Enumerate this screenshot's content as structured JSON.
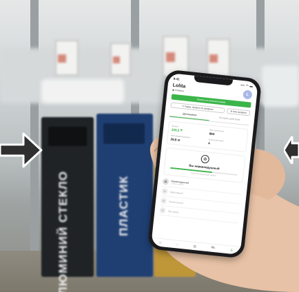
{
  "background": {
    "bins": [
      {
        "label": "АЛЮМИНИЙ СТЕКЛО",
        "color": "#1f2326"
      },
      {
        "label": "ПЛАСТИК",
        "color": "#1f3f73"
      }
    ]
  },
  "phone": {
    "status": {
      "time": "9:41",
      "signal": "▪▪▪ ◠ ▬"
    },
    "profile": {
      "name": "Lolita",
      "city": "Алматы",
      "avatar_letter": "L"
    },
    "primary_action": "Кнопка на зеленом экране",
    "secondary_actions": [
      "Рядом, правила по профилю",
      "Мои профили"
    ],
    "tabs": [
      {
        "label": "Достижения",
        "active": true
      },
      {
        "label": "История действий",
        "active": false
      }
    ],
    "stats": [
      {
        "label": "Баланс",
        "value": "328,5 ₸",
        "accent": true
      },
      {
        "label": "Мое количество",
        "value": "884",
        "accent": false
      },
      {
        "label": "Мой общий результат",
        "value": "29,8 кг",
        "accent": false
      },
      {
        "label": "Количество мест",
        "value": "4",
        "accent": false
      }
    ],
    "level": {
      "icon": "♻",
      "title": "Вы неравнодушный",
      "progress": 0.62,
      "subtitle": "Ещё 3 до следующего уровня"
    },
    "levels": [
      {
        "name": "Неравнодушный",
        "sub": "Текущий уровень",
        "active": true
      },
      {
        "name": "Заботливый",
        "sub": "",
        "active": false
      },
      {
        "name": "Экологичный",
        "sub": "",
        "active": false
      },
      {
        "name": "Эко-герой",
        "sub": "",
        "active": false
      }
    ],
    "nav_icons": [
      "map-icon",
      "home-icon",
      "grid-icon",
      "cart-icon",
      "profile-icon"
    ]
  },
  "colors": {
    "accent": "#3bb54a",
    "arrow": "#2f2f2f"
  }
}
